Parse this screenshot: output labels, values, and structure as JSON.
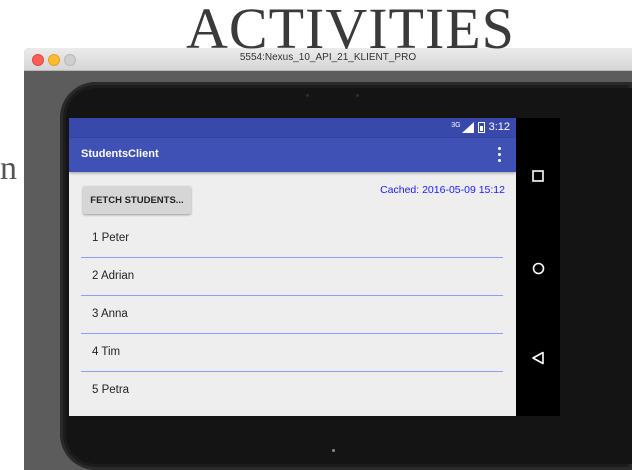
{
  "slide": {
    "title": "ACTIVITIES",
    "left_fragment": "n"
  },
  "emulator": {
    "window_title": "5554:Nexus_10_API_21_KLIENT_PRO"
  },
  "status_bar": {
    "network": "3G",
    "time": "3:12"
  },
  "app_bar": {
    "title": "StudentsClient",
    "overflow_icon": "more-vert-icon"
  },
  "main": {
    "fetch_button_label": "FETCH STUDENTS...",
    "cached_text": "Cached: 2016-05-09 15:12",
    "students": [
      "1 Peter",
      "2 Adrian",
      "3 Anna",
      "4 Tim",
      "5 Petra"
    ]
  },
  "nav_bar": {
    "buttons": [
      "recents-icon",
      "home-icon",
      "back-icon"
    ]
  },
  "colors": {
    "status_bar": "#3949ab",
    "app_bar": "#3f51b5",
    "divider": "#8c9eff",
    "cached_text": "#1a1aff"
  }
}
